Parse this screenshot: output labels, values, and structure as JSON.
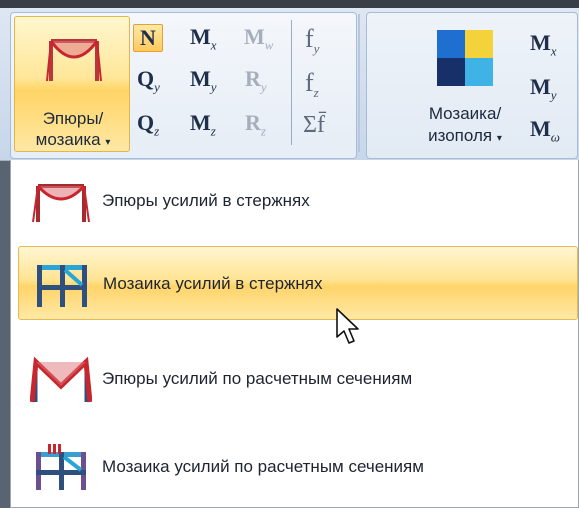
{
  "ribbon": {
    "plots_button": {
      "line1": "Эпюры/",
      "line2": "мозаика",
      "caret": "▾"
    },
    "mosaic_button": {
      "line1": "Мозаика/",
      "line2": "изополя",
      "caret": "▾"
    },
    "force_grid": [
      [
        "N",
        "M",
        "M"
      ],
      [
        "Q",
        "M",
        "R"
      ],
      [
        "Q",
        "M",
        "R"
      ]
    ],
    "force_subscripts": [
      [
        "",
        "x",
        "w"
      ],
      [
        "y",
        "y",
        "y"
      ],
      [
        "z",
        "z",
        "z"
      ]
    ],
    "f_column": [
      "f",
      "f",
      "Σf̄"
    ],
    "f_subscripts": [
      "y",
      "z",
      ""
    ],
    "right_column": [
      "M",
      "M",
      "M"
    ],
    "right_subscripts": [
      "x",
      "y",
      "ω"
    ]
  },
  "menu": {
    "items": [
      {
        "label": "Эпюры усилий в стержнях",
        "icon": "bar-force-diagram-icon"
      },
      {
        "label": "Мозаика усилий в стержнях",
        "icon": "bar-force-mosaic-icon",
        "highlighted": true
      },
      {
        "label": "Эпюры усилий по расчетным сечениям",
        "icon": "section-force-diagram-icon"
      },
      {
        "label": "Мозаика усилий по расчетным сечениям",
        "icon": "section-force-mosaic-icon"
      }
    ]
  },
  "colors": {
    "highlight": "#ffd46a",
    "diagram_red": "#c8262e",
    "frame_blue": "#2f4f7f"
  }
}
